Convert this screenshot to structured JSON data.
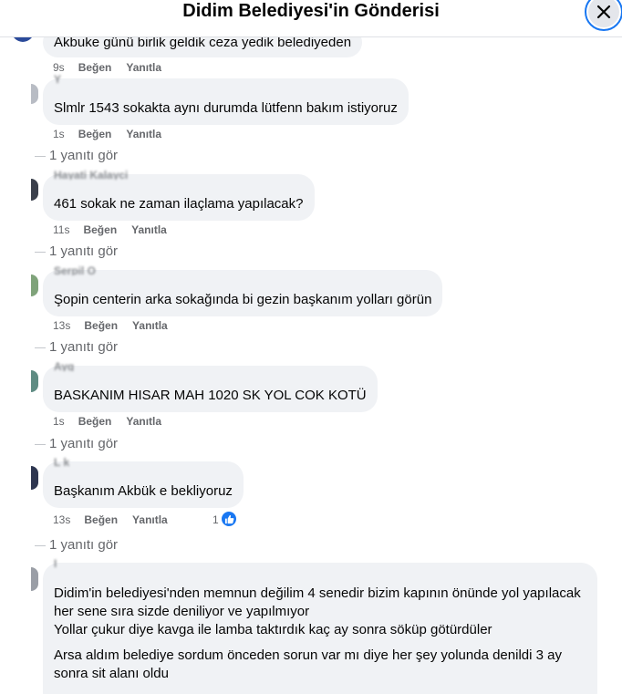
{
  "header": {
    "title": "Didim Belediyesi'in Gönderisi"
  },
  "actions_labels": {
    "like": "Beğen",
    "reply": "Yanıtla",
    "view_replies": "1 yanıtı gör"
  },
  "comments": [
    {
      "text": "Akbuke günü birlik geldik ceza yedik belediyeden",
      "time": "9s"
    },
    {
      "author": "Y",
      "text": "Slmlr 1543 sokakta aynı durumda lütfenn bakım istiyoruz",
      "time": "1s"
    },
    {
      "author": "Hayati Kalayci",
      "text": "461 sokak ne zaman ilaçlama yapılacak?",
      "time": "11s"
    },
    {
      "author": "Serpil O",
      "text": "Şopin centerin arka sokağında bi gezin başkanım yolları görün",
      "time": "13s"
    },
    {
      "author": "Ayg",
      "text": "BASKANIM HISAR MAH 1020 SK YOL COK KOTÜ",
      "time": "1s"
    },
    {
      "author": "L k",
      "text": "Başkanım Akbük e bekliyoruz",
      "time": "13s",
      "likes": "1"
    },
    {
      "author": "I",
      "paragraphs": [
        "Didim'in belediyesi'nden memnun değilim 4 senedir bizim kapının önünde yol yapılacak her sene sıra sizde deniliyor ve yapılmıyor",
        "Yollar çukur diye kavga ile lamba taktırdık kaç ay sonra söküp götürdüler",
        "Arsa aldım belediye sordum önceden sorun var mı diye her şey yolunda denildi 3 ay sonra sit alanı oldu"
      ]
    }
  ],
  "colors": {
    "bubble": "#f0f2f5",
    "secondary_text": "#65676b",
    "accent": "#1877f2"
  },
  "icons": {
    "close": "close-icon",
    "like_badge": "thumbs-up-icon"
  }
}
